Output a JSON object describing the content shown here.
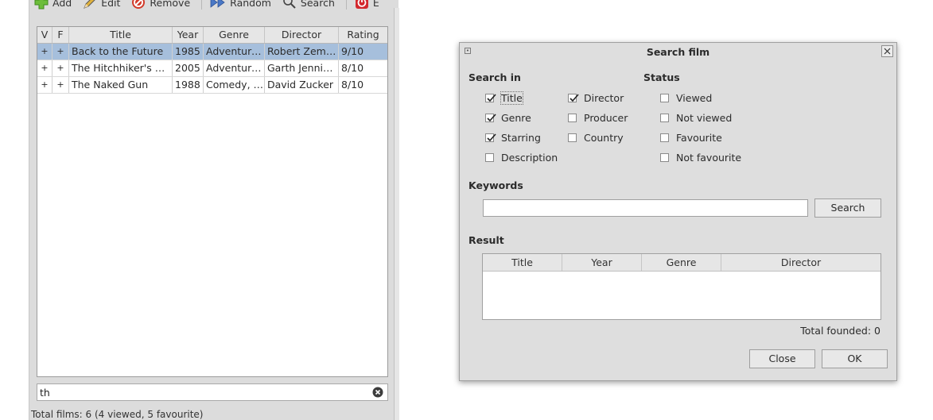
{
  "toolbar": {
    "items": [
      {
        "label": "Add",
        "icon": "plus-icon"
      },
      {
        "label": "Edit",
        "icon": "pencil-icon"
      },
      {
        "label": "Remove",
        "icon": "remove-icon"
      },
      {
        "label": "Random",
        "icon": "fast-forward-icon"
      },
      {
        "label": "Search",
        "icon": "magnifier-icon"
      },
      {
        "label": "E",
        "icon": "power-icon"
      }
    ]
  },
  "films_table": {
    "columns": [
      "V",
      "F",
      "Title",
      "Year",
      "Genre",
      "Director",
      "Rating"
    ],
    "rows": [
      {
        "v": "+",
        "f": "+",
        "title": "Back to the Future",
        "year": "1985",
        "genre": "Adventure…",
        "director": "Robert Zem…",
        "rating": "9/10",
        "selected": true
      },
      {
        "v": "+",
        "f": "+",
        "title": "The Hitchhiker's G…",
        "year": "2005",
        "genre": "Adventure…",
        "director": "Garth Jenni…",
        "rating": "8/10",
        "selected": false
      },
      {
        "v": "+",
        "f": "+",
        "title": "The Naked Gun",
        "year": "1988",
        "genre": "Comedy, …",
        "director": "David Zucker",
        "rating": "8/10",
        "selected": false
      }
    ]
  },
  "filter": {
    "value": "th"
  },
  "statusbar": {
    "text": "Total films: 6 (4 viewed, 5 favourite)"
  },
  "dialog": {
    "title": "Search film",
    "search_in_label": "Search in",
    "status_label": "Status",
    "search_in": [
      {
        "label": "Title",
        "checked": true
      },
      {
        "label": "Genre",
        "checked": true
      },
      {
        "label": "Starring",
        "checked": true
      },
      {
        "label": "Description",
        "checked": false
      },
      {
        "label": "Director",
        "checked": true
      },
      {
        "label": "Producer",
        "checked": false
      },
      {
        "label": "Country",
        "checked": false
      }
    ],
    "status": [
      {
        "label": "Viewed",
        "checked": false
      },
      {
        "label": "Not viewed",
        "checked": false
      },
      {
        "label": "Favourite",
        "checked": false
      },
      {
        "label": "Not favourite",
        "checked": false
      }
    ],
    "keywords_label": "Keywords",
    "keywords_value": "",
    "search_button": "Search",
    "result_label": "Result",
    "result_columns": [
      "Title",
      "Year",
      "Genre",
      "Director"
    ],
    "total_found": "Total founded: 0",
    "close_button": "Close",
    "ok_button": "OK"
  },
  "colors": {
    "selection": "#a6bfdc",
    "window_bg": "#dcdcdc",
    "dialog_bg": "#dedede"
  }
}
